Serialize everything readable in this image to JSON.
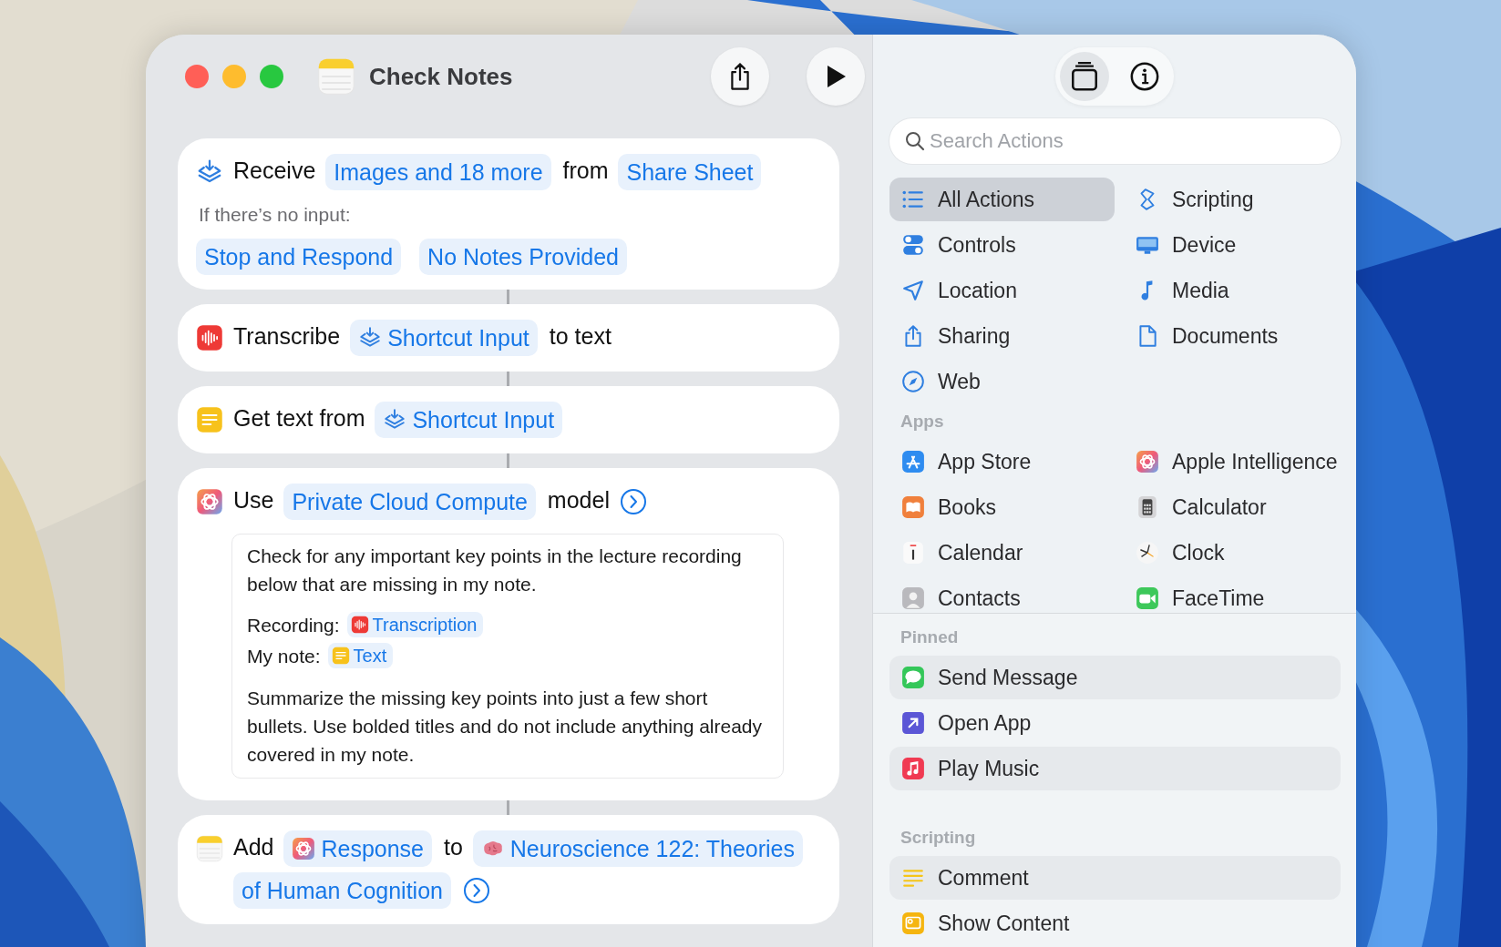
{
  "window": {
    "title": "Check Notes"
  },
  "actions": [
    {
      "kind": "receive",
      "segments": [
        {
          "kind": "text",
          "text": "Receive"
        },
        {
          "kind": "token",
          "text": "Images and 18 more"
        },
        {
          "kind": "text",
          "text": "from"
        },
        {
          "kind": "token",
          "text": "Share Sheet"
        }
      ],
      "caption": "If there’s no input:",
      "options": [
        "Stop and Respond",
        "No Notes Provided"
      ]
    },
    {
      "kind": "transcribe",
      "segments": [
        {
          "kind": "text",
          "text": "Transcribe"
        },
        {
          "kind": "input",
          "text": "Shortcut Input"
        },
        {
          "kind": "text",
          "text": "to text"
        }
      ]
    },
    {
      "kind": "gettext",
      "segments": [
        {
          "kind": "text",
          "text": "Get text from"
        },
        {
          "kind": "input",
          "text": "Shortcut Input"
        }
      ]
    },
    {
      "kind": "ai",
      "segments": [
        {
          "kind": "text",
          "text": "Use"
        },
        {
          "kind": "token",
          "text": "Private Cloud Compute"
        },
        {
          "kind": "text",
          "text": "model"
        },
        {
          "kind": "chevron"
        }
      ],
      "prompt": [
        {
          "kind": "paragraph",
          "text": "Check for any important key points in the lecture recording below that are missing in my note."
        },
        {
          "kind": "variable",
          "label": "Recording:",
          "token": {
            "kind": "transcribe",
            "text": "Transcription"
          }
        },
        {
          "kind": "variable",
          "label": "My note:",
          "token": {
            "kind": "gettext",
            "text": "Text"
          }
        },
        {
          "kind": "paragraph",
          "text": "Summarize the missing key points into just a few short bullets. Use bolded titles and do not include anything already covered in my note."
        }
      ]
    },
    {
      "kind": "notes",
      "segments": [
        {
          "kind": "text",
          "text": "Add"
        },
        {
          "kind": "ai",
          "text": "Response"
        },
        {
          "kind": "text",
          "text": "to"
        },
        {
          "kind": "note",
          "text": "Neuroscience 122: Theories"
        },
        {
          "kind": "token",
          "text": "of Human Cognition"
        },
        {
          "kind": "chevron"
        }
      ]
    }
  ],
  "sidebar": {
    "search": {
      "placeholder": "Search Actions"
    },
    "categories": [
      {
        "label": "All Actions",
        "selected": true
      },
      {
        "label": "Scripting",
        "selected": false
      },
      {
        "label": "Controls",
        "selected": false
      },
      {
        "label": "Device",
        "selected": false
      },
      {
        "label": "Location",
        "selected": false
      },
      {
        "label": "Media",
        "selected": false
      },
      {
        "label": "Sharing",
        "selected": false
      },
      {
        "label": "Documents",
        "selected": false
      },
      {
        "label": "Web",
        "selected": false
      }
    ],
    "apps": {
      "heading": "Apps",
      "items": [
        "App Store",
        "Apple Intelligence",
        "Books",
        "Calculator",
        "Calendar",
        "Clock",
        "Contacts",
        "FaceTime"
      ]
    },
    "pinned": {
      "heading": "Pinned",
      "items": [
        "Send Message",
        "Open App",
        "Play Music"
      ]
    },
    "scripting": {
      "heading": "Scripting",
      "items": [
        "Comment",
        "Show Content"
      ]
    }
  }
}
